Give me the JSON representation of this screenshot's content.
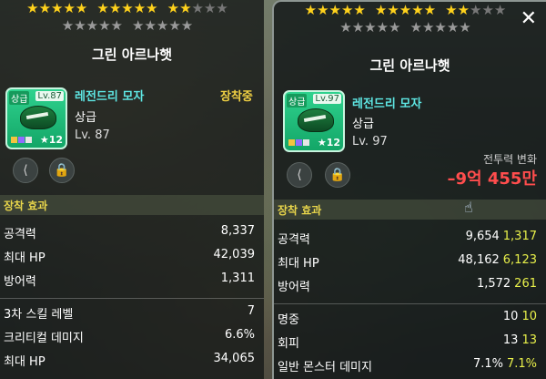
{
  "left": {
    "stars_top": [
      "★★★★★",
      "★★★★★",
      "★★★★★"
    ],
    "stars_bottom": [
      "★★★★★",
      "★★★★★"
    ],
    "title": "그린 아르나햇",
    "icon": {
      "grade_tag": "상급",
      "lv_tag": "Lv.87",
      "star_count": "12"
    },
    "item_name": "레전드리 모자",
    "grade": "상급",
    "level": "Lv. 87",
    "equipped": "장착중",
    "section": "장착 효과",
    "stats": [
      {
        "k": "공격력",
        "v": "8,337"
      },
      {
        "k": "최대 HP",
        "v": "42,039"
      },
      {
        "k": "방어력",
        "v": "1,311"
      },
      {
        "k": "3차 스킬 레벨",
        "v": "7"
      },
      {
        "k": "크리티컬 데미지",
        "v": "6.6%"
      },
      {
        "k": "최대 HP",
        "v": "34,065"
      }
    ]
  },
  "right": {
    "stars_top": [
      "★★★★★",
      "★★★★★",
      "★★★★★"
    ],
    "stars_bottom": [
      "★★★★★",
      "★★★★★"
    ],
    "title": "그린 아르나햇",
    "icon": {
      "grade_tag": "상급",
      "lv_tag": "Lv.97",
      "star_count": "12"
    },
    "item_name": "레전드리 모자",
    "grade": "상급",
    "level": "Lv. 97",
    "cp_label": "전투력 변화",
    "cp_value": "–9억 455만",
    "section": "장착 효과",
    "stats": [
      {
        "k": "공격력",
        "base": "9,654",
        "bonus": "1,317"
      },
      {
        "k": "최대 HP",
        "base": "48,162",
        "bonus": "6,123"
      },
      {
        "k": "방어력",
        "base": "1,572",
        "bonus": "261"
      },
      {
        "k": "명중",
        "base": "10",
        "bonus": "10"
      },
      {
        "k": "회피",
        "base": "13",
        "bonus": "13"
      },
      {
        "k": "일반 몬스터 데미지",
        "base": "7.1%",
        "bonus": "7.1%"
      }
    ],
    "close": "✕"
  },
  "colors": {
    "equipped": "#f0d043",
    "name": "#5ee7e4",
    "bonus": "#e8f04a",
    "cp": "#ff4d4d"
  },
  "icons": {
    "share": "share-icon",
    "lock": "lock-icon",
    "close": "close-icon"
  }
}
